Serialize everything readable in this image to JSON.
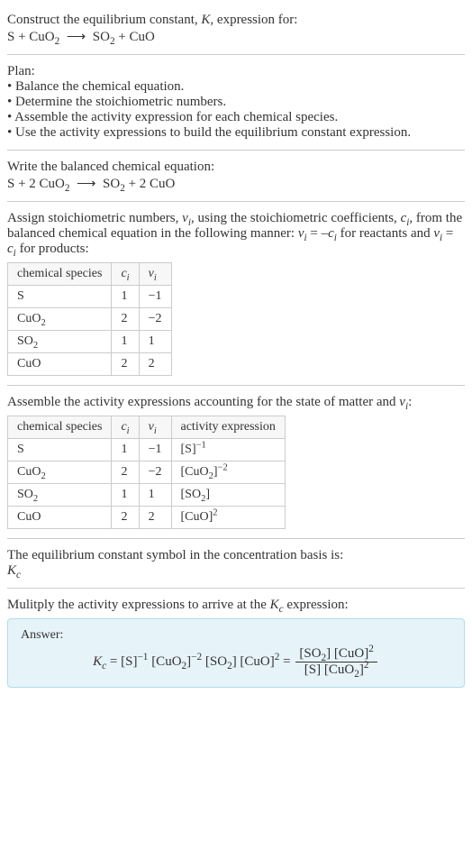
{
  "header": {
    "line1": "Construct the equilibrium constant, <i>K</i>, expression for:",
    "eq": "S + CuO<sub>2</sub> &nbsp;⟶&nbsp; SO<sub>2</sub> + CuO"
  },
  "plan": {
    "title": "Plan:",
    "items": [
      "• Balance the chemical equation.",
      "• Determine the stoichiometric numbers.",
      "• Assemble the activity expression for each chemical species.",
      "• Use the activity expressions to build the equilibrium constant expression."
    ]
  },
  "balanced": {
    "title": "Write the balanced chemical equation:",
    "eq": "S + 2 CuO<sub>2</sub> &nbsp;⟶&nbsp; SO<sub>2</sub> + 2 CuO"
  },
  "stoich": {
    "text": "Assign stoichiometric numbers, <i>ν<sub>i</sub></i>, using the stoichiometric coefficients, <i>c<sub>i</sub></i>, from the balanced chemical equation in the following manner: <i>ν<sub>i</sub></i> = –<i>c<sub>i</sub></i> for reactants and <i>ν<sub>i</sub></i> = <i>c<sub>i</sub></i> for products:",
    "headers": [
      "chemical species",
      "<i>c<sub>i</sub></i>",
      "<i>ν<sub>i</sub></i>"
    ],
    "rows": [
      [
        "S",
        "1",
        "−1"
      ],
      [
        "CuO<sub>2</sub>",
        "2",
        "−2"
      ],
      [
        "SO<sub>2</sub>",
        "1",
        "1"
      ],
      [
        "CuO",
        "2",
        "2"
      ]
    ]
  },
  "activity": {
    "text": "Assemble the activity expressions accounting for the state of matter and <i>ν<sub>i</sub></i>:",
    "headers": [
      "chemical species",
      "<i>c<sub>i</sub></i>",
      "<i>ν<sub>i</sub></i>",
      "activity expression"
    ],
    "rows": [
      [
        "S",
        "1",
        "−1",
        "[S]<sup>−1</sup>"
      ],
      [
        "CuO<sub>2</sub>",
        "2",
        "−2",
        "[CuO<sub>2</sub>]<sup>−2</sup>"
      ],
      [
        "SO<sub>2</sub>",
        "1",
        "1",
        "[SO<sub>2</sub>]"
      ],
      [
        "CuO",
        "2",
        "2",
        "[CuO]<sup>2</sup>"
      ]
    ]
  },
  "symbol": {
    "line1": "The equilibrium constant symbol in the concentration basis is:",
    "line2": "<i>K<sub>c</sub></i>"
  },
  "multiply": {
    "text": "Mulitply the activity expressions to arrive at the <i>K<sub>c</sub></i> expression:"
  },
  "answer": {
    "label": "Answer:",
    "lhs": "<i>K<sub>c</sub></i> = [S]<sup>−1</sup> [CuO<sub>2</sub>]<sup>−2</sup> [SO<sub>2</sub>] [CuO]<sup>2</sup> = ",
    "num": "[SO<sub>2</sub>] [CuO]<sup>2</sup>",
    "den": "[S] [CuO<sub>2</sub>]<sup>2</sup>"
  }
}
